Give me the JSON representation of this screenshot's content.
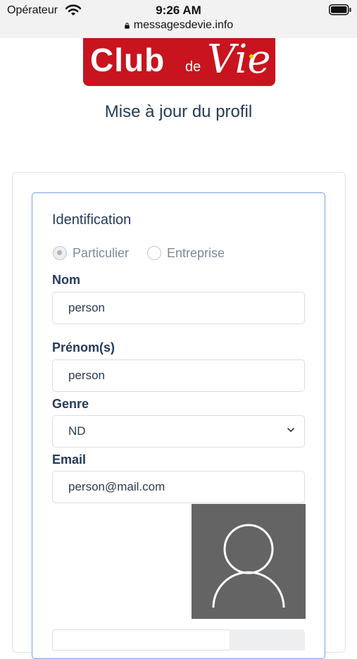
{
  "status_bar": {
    "carrier": "Opérateur",
    "time": "9:26 AM",
    "url": "messagesdevie.info"
  },
  "logo": {
    "club": "Club",
    "de": "de",
    "vie": "Vie"
  },
  "page_title": "Mise à jour du profil",
  "form": {
    "section_title": "Identification",
    "radio_options": [
      {
        "label": "Particulier",
        "checked": true
      },
      {
        "label": "Entreprise",
        "checked": false
      }
    ],
    "fields": {
      "nom": {
        "label": "Nom",
        "value": "person"
      },
      "prenom": {
        "label": "Prénom(s)",
        "value": "person"
      },
      "genre": {
        "label": "Genre",
        "value": "ND"
      },
      "email": {
        "label": "Email",
        "value": "person@mail.com"
      }
    }
  },
  "colors": {
    "brand_red": "#c8141e",
    "title_navy": "#253a5a",
    "fieldset_border": "#7b9ce8",
    "avatar_bg": "#646464"
  }
}
